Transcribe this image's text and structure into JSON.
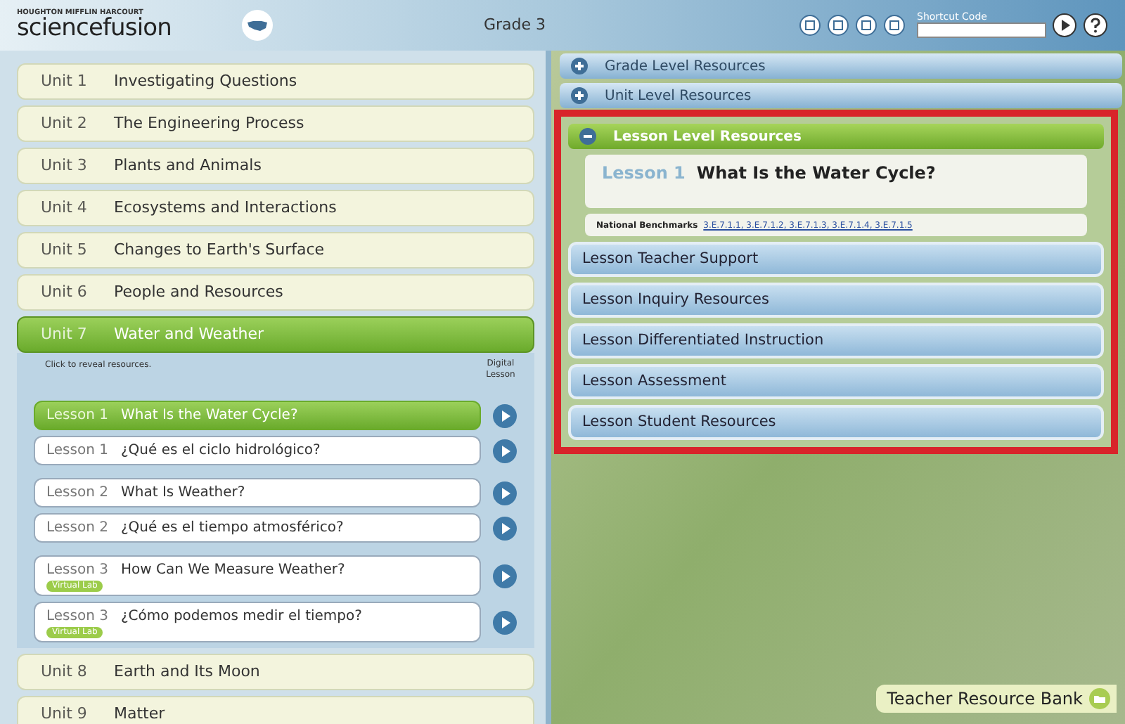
{
  "header": {
    "publisher": "HOUGHTON MIFFLIN HARCOURT",
    "logo": "sciencefusion",
    "grade": "Grade 3",
    "shortcut_label": "Shortcut Code"
  },
  "units": [
    {
      "number": "Unit 1",
      "title": "Investigating Questions",
      "selected": false
    },
    {
      "number": "Unit 2",
      "title": "The Engineering Process",
      "selected": false
    },
    {
      "number": "Unit 3",
      "title": "Plants and Animals",
      "selected": false
    },
    {
      "number": "Unit 4",
      "title": "Ecosystems and Interactions",
      "selected": false
    },
    {
      "number": "Unit 5",
      "title": "Changes to Earth's Surface",
      "selected": false
    },
    {
      "number": "Unit 6",
      "title": "People and Resources",
      "selected": false
    },
    {
      "number": "Unit 7",
      "title": "Water and Weather",
      "selected": true,
      "hint": "Click to reveal resources.",
      "column_label": "Digital Lesson",
      "lessons": [
        {
          "number": "Lesson 1",
          "title": "What Is the Water Cycle?",
          "selected": true
        },
        {
          "number": "Lesson 1",
          "title": "¿Qué es el ciclo hidrológico?",
          "selected": false
        },
        {
          "number": "Lesson 2",
          "title": "What Is Weather?",
          "selected": false
        },
        {
          "number": "Lesson 2",
          "title": "¿Qué es el tiempo atmosférico?",
          "selected": false
        },
        {
          "number": "Lesson 3",
          "title": "How Can We Measure Weather?",
          "selected": false,
          "badge": "Virtual Lab"
        },
        {
          "number": "Lesson 3",
          "title": "¿Cómo podemos medir el tiempo?",
          "selected": false,
          "badge": "Virtual Lab"
        }
      ]
    },
    {
      "number": "Unit 8",
      "title": "Earth and Its Moon",
      "selected": false
    },
    {
      "number": "Unit 9",
      "title": "Matter",
      "selected": false
    }
  ],
  "resources": {
    "sections": [
      {
        "title": "Grade Level Resources",
        "expanded": false
      },
      {
        "title": "Unit Level Resources",
        "expanded": false
      },
      {
        "title": "Lesson Level Resources",
        "expanded": true
      }
    ],
    "lesson_number": "Lesson 1",
    "lesson_title": "What Is the Water Cycle?",
    "benchmarks_label": "National Benchmarks",
    "benchmarks": "3.E.7.1.1, 3.E.7.1.2, 3.E.7.1.3, 3.E.7.1.4, 3.E.7.1.5",
    "buttons": [
      "Lesson Teacher Support",
      "Lesson Inquiry Resources",
      "Lesson Differentiated Instruction",
      "Lesson Assessment",
      "Lesson Student Resources"
    ]
  },
  "teacher_bank": "Teacher Resource Bank"
}
